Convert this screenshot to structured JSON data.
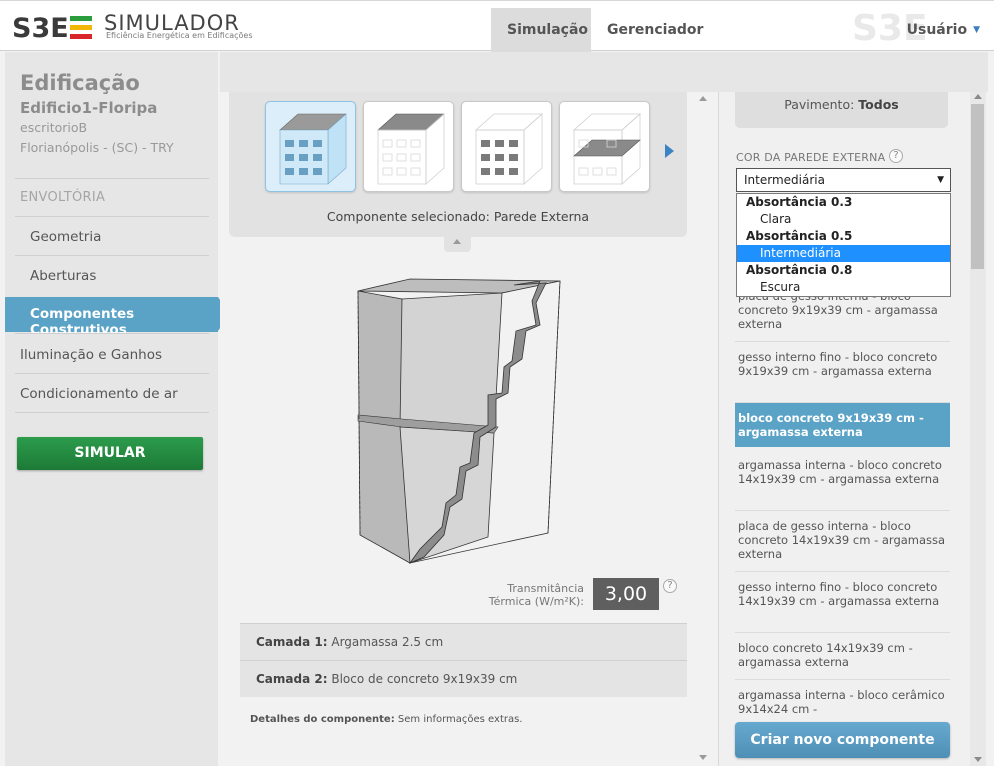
{
  "header": {
    "logo_mark": "S3E",
    "logo_title": "SIMULADOR",
    "logo_subtitle": "Eficiência Energética em Edificações",
    "tabs": [
      {
        "label": "Simulação",
        "active": true
      },
      {
        "label": "Gerenciador",
        "active": false
      }
    ],
    "user_label": "Usuário"
  },
  "sidebar": {
    "title": "Edificação",
    "building_name": "Edificio1-Floripa",
    "building_type": "escritorioB",
    "location": "Florianópolis - (SC) - TRY",
    "section_label": "ENVOLTÓRIA",
    "items": [
      {
        "label": "Geometria"
      },
      {
        "label": "Aberturas"
      },
      {
        "label": "Componentes Construtivos",
        "active": true
      }
    ],
    "top_items": [
      {
        "label": "Iluminação e Ganhos"
      },
      {
        "label": "Condicionamento de ar"
      }
    ],
    "simulate_label": "SIMULAR"
  },
  "components": {
    "thumbnails": [
      {
        "icon": "external-wall-icon",
        "selected": true
      },
      {
        "icon": "roof-icon",
        "selected": false
      },
      {
        "icon": "internal-wall-icon",
        "selected": false
      },
      {
        "icon": "floor-icon",
        "selected": false
      }
    ],
    "selected_prefix": "Componente selecionado:",
    "selected_value": "Parede Externa"
  },
  "transmittance": {
    "label_line1": "Transmitância",
    "label_line2": "Térmica (W/m²K):",
    "value": "3,00",
    "help": "?"
  },
  "layers": [
    {
      "prefix": "Camada 1:",
      "value": "Argamassa 2.5 cm"
    },
    {
      "prefix": "Camada 2:",
      "value": "Bloco de concreto 9x19x39 cm"
    }
  ],
  "details": {
    "prefix": "Detalhes do componente:",
    "value": "Sem informações extras."
  },
  "right_panel": {
    "pavimento_prefix": "Pavimento:",
    "pavimento_value": "Todos",
    "color_label": "COR DA PAREDE EXTERNA",
    "help": "?",
    "select_value": "Intermediária",
    "dropdown": [
      {
        "type": "group",
        "label": "Absortância 0.3"
      },
      {
        "type": "option",
        "label": "Clara"
      },
      {
        "type": "group",
        "label": "Absortância 0.5"
      },
      {
        "type": "option",
        "label": "Intermediária",
        "highlighted": true
      },
      {
        "type": "group",
        "label": "Absortância 0.8"
      },
      {
        "type": "option",
        "label": "Escura"
      }
    ],
    "list": [
      {
        "label": "placa de gesso interna - bloco concreto 9x19x39 cm - argamassa externa"
      },
      {
        "label": "gesso interno fino - bloco concreto 9x19x39 cm - argamassa externa"
      },
      {
        "label": "bloco concreto 9x19x39 cm - argamassa externa",
        "selected": true
      },
      {
        "label": "argamassa interna - bloco concreto 14x19x39 cm - argamassa externa"
      },
      {
        "label": "placa de gesso interna - bloco concreto 14x19x39 cm - argamassa externa"
      },
      {
        "label": "gesso interno fino - bloco concreto 14x19x39 cm - argamassa externa"
      },
      {
        "label": "bloco concreto 14x19x39 cm - argamassa externa"
      },
      {
        "label": "argamassa interna - bloco cerâmico 9x14x24 cm -"
      }
    ],
    "create_label": "Criar novo componente"
  },
  "colors": {
    "accent": "#5ba3c6",
    "simulate": "#1f8a3c",
    "dropdown_highlight": "#1e90ff",
    "logo_green": "#2a9d3f",
    "logo_yellow": "#f2b705",
    "logo_red": "#d9262b"
  }
}
